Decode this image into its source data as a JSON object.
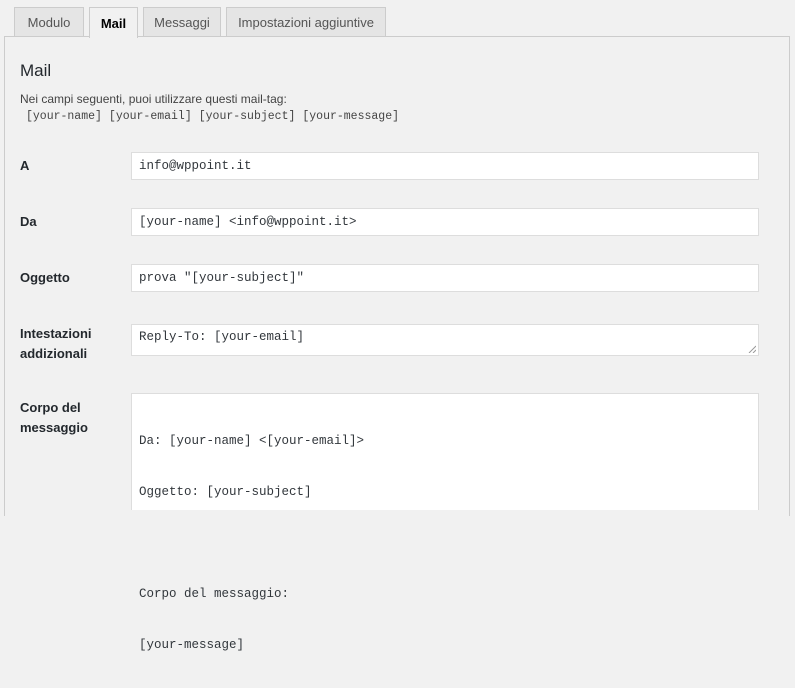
{
  "tabs": [
    {
      "label": "Modulo",
      "active": false
    },
    {
      "label": "Mail",
      "active": true
    },
    {
      "label": "Messaggi",
      "active": false
    },
    {
      "label": "Impostazioni aggiuntive",
      "active": false
    }
  ],
  "mail": {
    "title": "Mail",
    "description": "Nei campi seguenti, puoi utilizzare questi mail-tag:",
    "tags": [
      "[your-name]",
      "[your-email]",
      "[your-subject]",
      "[your-message]"
    ],
    "fields": {
      "to": {
        "label": "A",
        "value": "info@wppoint.it"
      },
      "from": {
        "label": "Da",
        "value": "[your-name] <info@wppoint.it>"
      },
      "subject": {
        "label": "Oggetto",
        "value": "prova \"[your-subject]\""
      },
      "headers": {
        "label_line1": "Intestazioni",
        "label_line2": "addizionali",
        "value": "Reply-To: [your-email]"
      },
      "body": {
        "label_line1": "Corpo del",
        "label_line2": "messaggio",
        "lines": [
          "Da: [your-name] <[your-email]>",
          "Oggetto: [your-subject]",
          "",
          "Corpo del messaggio:",
          "[your-message]"
        ]
      }
    }
  }
}
